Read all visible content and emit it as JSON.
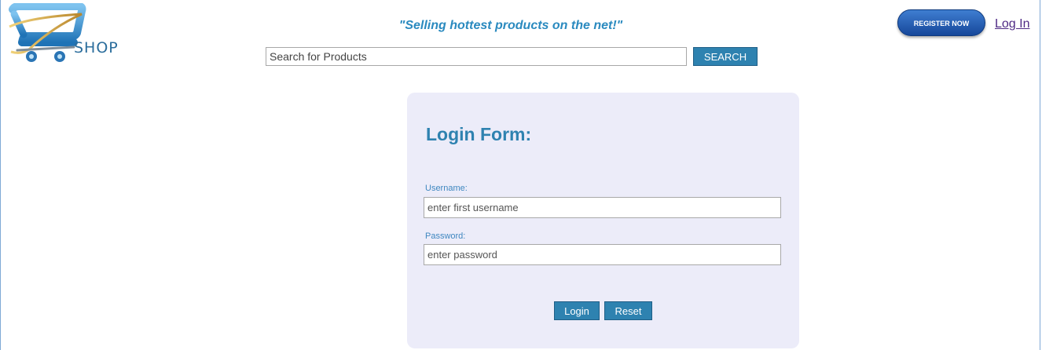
{
  "header": {
    "logo_text": "SHOP",
    "tagline": "\"Selling hottest products on the net!\"",
    "search": {
      "placeholder": "Search for Products",
      "value": ""
    },
    "search_button_label": "SEARCH",
    "register_button_label": "REGISTER NOW",
    "login_link_label": "Log In"
  },
  "login_form": {
    "title": "Login Form:",
    "username_label": "Username:",
    "username_placeholder": "enter first username",
    "password_label": "Password:",
    "password_placeholder": "enter password",
    "login_button_label": "Login",
    "reset_button_label": "Reset"
  },
  "colors": {
    "accent": "#2e82b0",
    "panel_background": "#ececf9",
    "register_button": "#2a63b8",
    "link": "#4f2a85"
  },
  "icons": {
    "logo": "shopping-cart-logo-icon"
  }
}
